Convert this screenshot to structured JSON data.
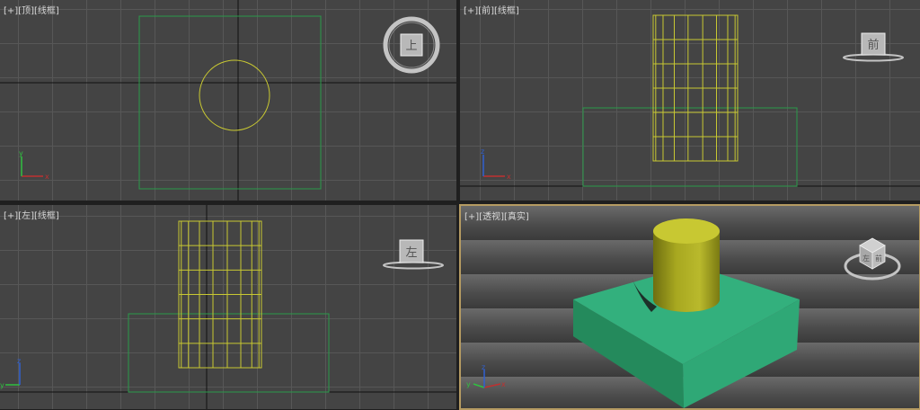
{
  "viewports": {
    "top": {
      "label_plus": "[+]",
      "label_view": "[顶]",
      "label_mode": "[线框]",
      "cube_face": "上"
    },
    "front": {
      "label_plus": "[+]",
      "label_view": "[前]",
      "label_mode": "[线框]",
      "cube_face": "前"
    },
    "left": {
      "label_plus": "[+]",
      "label_view": "[左]",
      "label_mode": "[线框]",
      "cube_face": "左"
    },
    "perspective": {
      "label_plus": "[+]",
      "label_view": "[透视]",
      "label_mode": "[真实]",
      "cube_face_front": "前",
      "cube_face_left": "左"
    }
  },
  "axes": {
    "x": "x",
    "y": "y",
    "z": "z"
  },
  "colors": {
    "viewport_bg": "#444444",
    "grid": "#575757",
    "wire_green": "#2a9a4a",
    "wire_yellow": "#c8c832",
    "box_shaded": "#2fa876",
    "cylinder_shaded": "#b8b82a",
    "active_border": "#b59b62"
  }
}
